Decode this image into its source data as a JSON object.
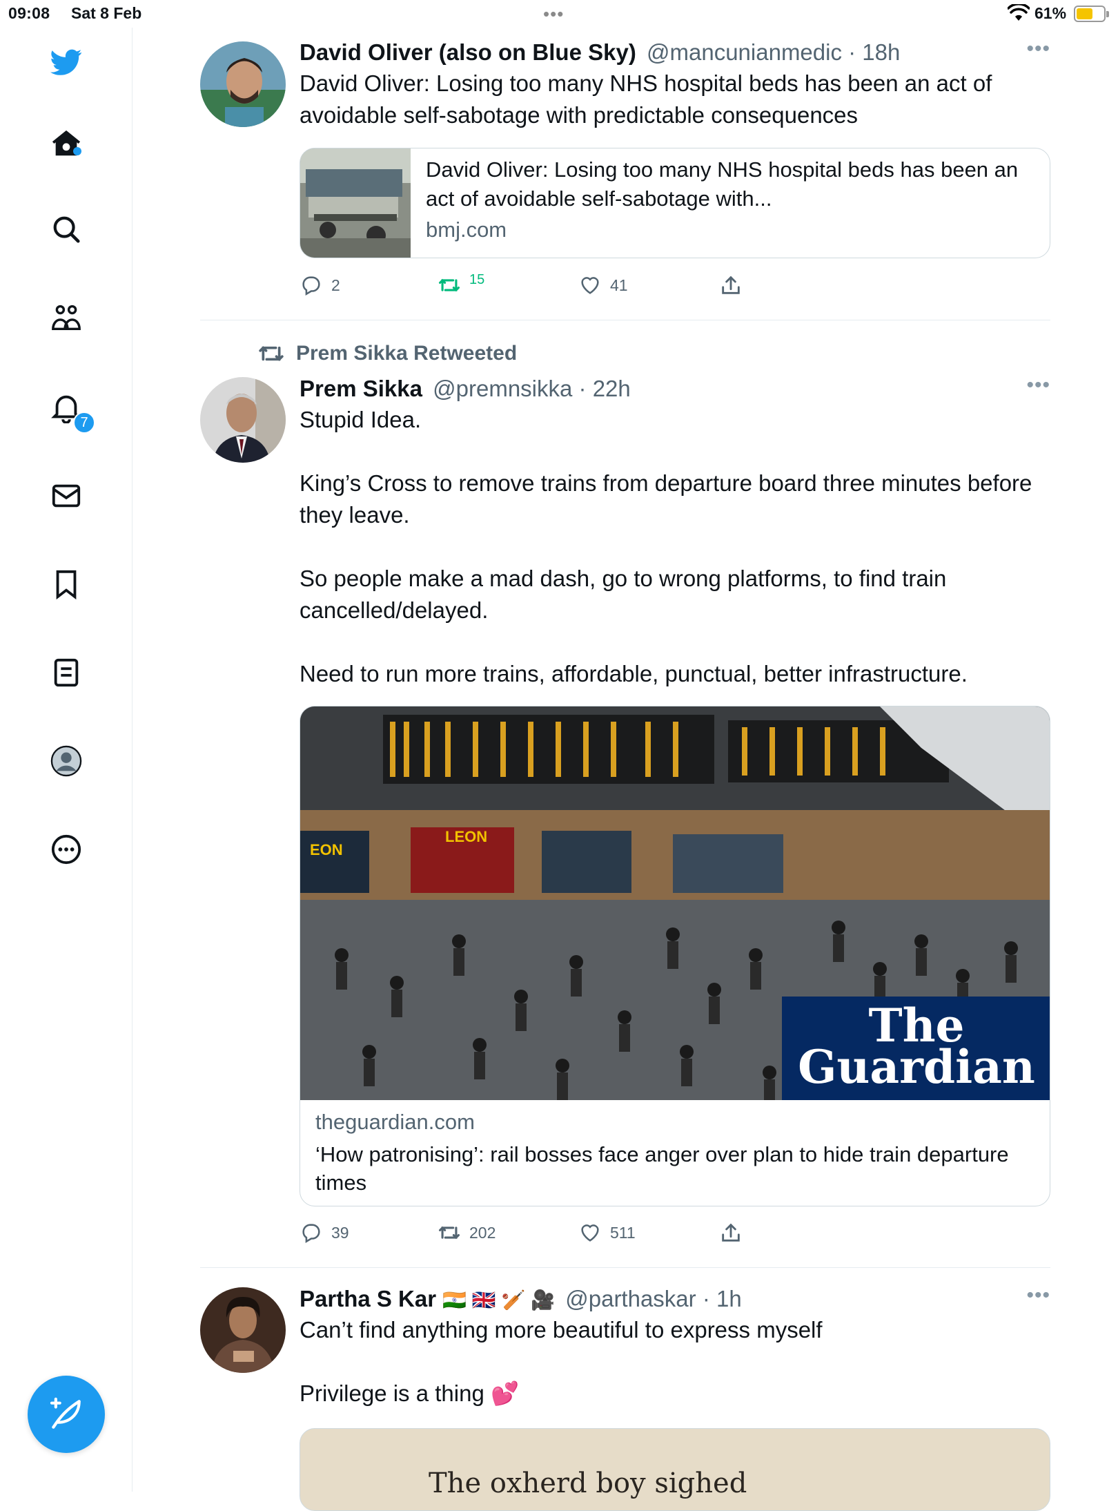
{
  "status_bar": {
    "time": "09:08",
    "date": "Sat 8 Feb",
    "multitask_dots": "•••",
    "battery_percent": "61%",
    "battery_level": 0.61
  },
  "sidebar": {
    "items": [
      {
        "name": "twitter-logo",
        "icon": "bird-icon",
        "color": "#1d9bf0"
      },
      {
        "name": "home",
        "icon": "home-icon",
        "has_dot": true
      },
      {
        "name": "explore",
        "icon": "search-icon"
      },
      {
        "name": "communities",
        "icon": "people-icon"
      },
      {
        "name": "notifications",
        "icon": "bell-icon",
        "badge": "7"
      },
      {
        "name": "messages",
        "icon": "envelope-icon"
      },
      {
        "name": "bookmarks",
        "icon": "bookmark-icon"
      },
      {
        "name": "lists",
        "icon": "list-icon"
      },
      {
        "name": "profile",
        "icon": "profile-icon"
      },
      {
        "name": "more",
        "icon": "more-circle-icon"
      }
    ],
    "compose_icon": "compose-feather-icon",
    "accent": "#1d9bf0"
  },
  "tweets": [
    {
      "name": "David Oliver (also on Blue Sky)",
      "handle": "@mancunianmedic",
      "time": "18h",
      "text": "David Oliver: Losing too many NHS hospital beds has been an act of avoidable self-sabotage with predictable consequences",
      "card": {
        "title": "David Oliver: Losing too many NHS hospital beds has been an act of avoidable self-sabotage with...",
        "domain": "bmj.com"
      },
      "replies": "2",
      "retweets": "15",
      "likes": "41",
      "retweeted_by_me": true
    },
    {
      "retweeted_by": "Prem Sikka Retweeted",
      "name": "Prem Sikka",
      "handle": "@premnsikka",
      "time": "22h",
      "text": "Stupid Idea.\n\nKing’s Cross to remove trains from departure board three minutes before they leave.\n\nSo people make a mad dash, go to wrong platforms, to find train cancelled/delayed.\n\nNeed to run more trains, affordable, punctual, better infrastructure.",
      "card": {
        "domain": "theguardian.com",
        "title": "‘How patronising’: rail bosses face anger over plan to hide train departure times",
        "brand_line1": "The",
        "brand_line2": "Guardian",
        "shop_sign_left": "EON",
        "shop_sign_right": "LEON"
      },
      "replies": "39",
      "retweets": "202",
      "likes": "511"
    },
    {
      "name": "Partha S Kar",
      "name_emoji": "🇮🇳 🇬🇧 🏏 🎥",
      "handle": "@parthaskar",
      "time": "1h",
      "text": "Can’t find anything more beautiful to express myself\n\nPrivilege is a thing 💕",
      "card": {
        "image_text": "The oxherd boy sighed"
      }
    }
  ],
  "ui": {
    "separator": "·",
    "more_glyph": "•••"
  }
}
